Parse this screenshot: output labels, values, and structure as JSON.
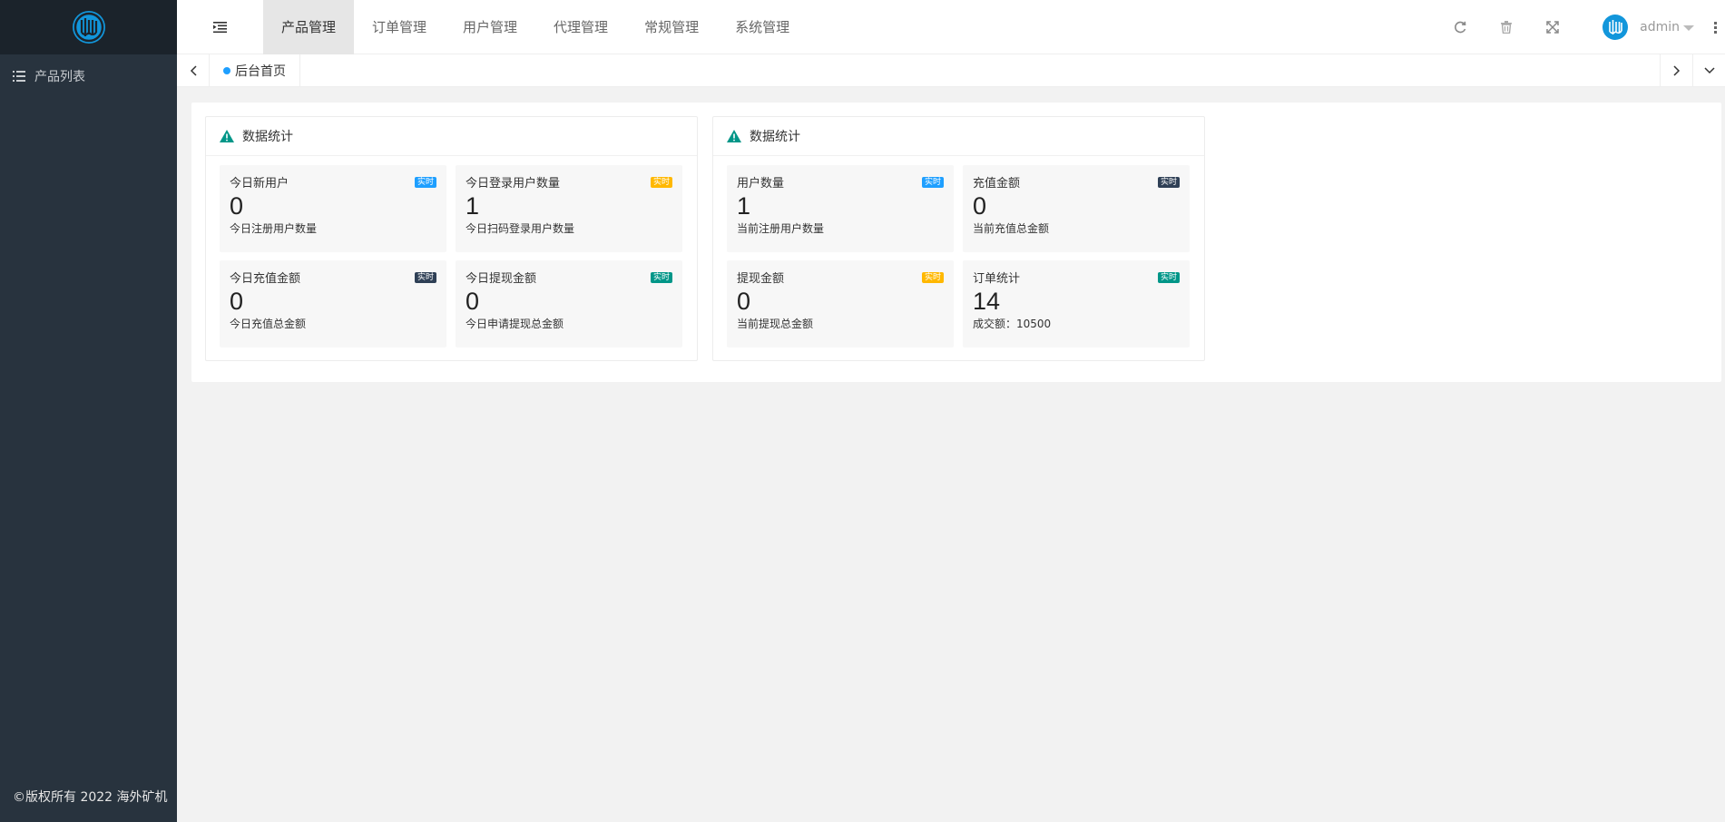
{
  "sidebar": {
    "items": [
      {
        "label": "产品列表",
        "icon": "list-icon"
      }
    ],
    "copyright": "©版权所有 2022 海外矿机"
  },
  "header": {
    "nav": [
      {
        "label": "产品管理",
        "active": true
      },
      {
        "label": "订单管理",
        "active": false
      },
      {
        "label": "用户管理",
        "active": false
      },
      {
        "label": "代理管理",
        "active": false
      },
      {
        "label": "常规管理",
        "active": false
      },
      {
        "label": "系统管理",
        "active": false
      }
    ],
    "user": "admin"
  },
  "tabbar": {
    "home": "后台首页"
  },
  "panels": [
    {
      "title": "数据统计",
      "cards": [
        {
          "title": "今日新用户",
          "value": "0",
          "desc": "今日注册用户数量",
          "badge": "实时",
          "badge_color": "#1e9fff"
        },
        {
          "title": "今日登录用户数量",
          "value": "1",
          "desc": "今日扫码登录用户数量",
          "badge": "实时",
          "badge_color": "#ffb800"
        },
        {
          "title": "今日充值金额",
          "value": "0",
          "desc": "今日充值总金额",
          "badge": "实时",
          "badge_color": "#2f4056"
        },
        {
          "title": "今日提现金额",
          "value": "0",
          "desc": "今日申请提现总金额",
          "badge": "实时",
          "badge_color": "#009688"
        }
      ]
    },
    {
      "title": "数据统计",
      "cards": [
        {
          "title": "用户数量",
          "value": "1",
          "desc": "当前注册用户数量",
          "badge": "实时",
          "badge_color": "#1e9fff"
        },
        {
          "title": "充值金额",
          "value": "0",
          "desc": "当前充值总金额",
          "badge": "实时",
          "badge_color": "#2f4056"
        },
        {
          "title": "提现金额",
          "value": "0",
          "desc": "当前提现总金额",
          "badge": "实时",
          "badge_color": "#ffb800"
        },
        {
          "title": "订单统计",
          "value": "14",
          "desc": "成交额：10500",
          "badge": "实时",
          "badge_color": "#009688"
        }
      ]
    }
  ],
  "colors": {
    "accent": "#1e9fff",
    "sidebar": "#28333e",
    "logo_bg": "#1b232b"
  }
}
